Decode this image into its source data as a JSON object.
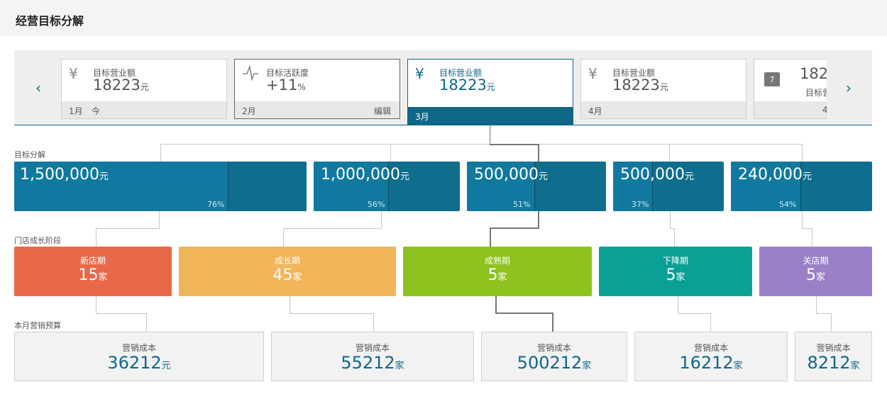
{
  "header": {
    "title": "经营目标分解"
  },
  "carousel": {
    "prev": "‹",
    "next": "›",
    "cards": [
      {
        "icon": "¥",
        "label": "目标营业额",
        "value": "18223",
        "unit": "元",
        "month": "1月",
        "tag": "今",
        "edit": ""
      },
      {
        "icon": "⁄",
        "label": "目标活跃度",
        "value": "+11",
        "unit": "%",
        "month": "2月",
        "tag": "",
        "edit": "编辑"
      },
      {
        "icon": "¥",
        "label": "目标营业额",
        "value": "18223",
        "unit": "元",
        "month": "3月",
        "tag": "",
        "edit": ""
      },
      {
        "icon": "¥",
        "label": "目标营业额",
        "value": "18223",
        "unit": "元",
        "month": "4月",
        "tag": "",
        "edit": ""
      },
      {
        "icon": "7",
        "label": "目标营",
        "value": "182",
        "unit": "",
        "month": "4",
        "tag": "",
        "edit": ""
      }
    ]
  },
  "targets": {
    "section_label": "目标分解",
    "items": [
      {
        "amount": "1,500,000",
        "unit": "元",
        "percent": "76%"
      },
      {
        "amount": "1,000,000",
        "unit": "元",
        "percent": "56%"
      },
      {
        "amount": "500,000",
        "unit": "元",
        "percent": "51%"
      },
      {
        "amount": "500,000",
        "unit": "元",
        "percent": "37%"
      },
      {
        "amount": "240,000",
        "unit": "元",
        "percent": "54%"
      }
    ]
  },
  "stages": {
    "section_label": "门店成长阶段",
    "items": [
      {
        "name": "新店期",
        "count": "15",
        "unit": "家",
        "color": "#e8694a"
      },
      {
        "name": "成长期",
        "count": "45",
        "unit": "家",
        "color": "#f2b55a"
      },
      {
        "name": "成熟期",
        "count": "5",
        "unit": "家",
        "color": "#8dc21f"
      },
      {
        "name": "下降期",
        "count": "5",
        "unit": "家",
        "color": "#0aa096"
      },
      {
        "name": "关店期",
        "count": "5",
        "unit": "家",
        "color": "#9b80c8"
      }
    ]
  },
  "budget": {
    "section_label": "本月营销预算",
    "items": [
      {
        "name": "营销成本",
        "value": "36212",
        "unit": "元"
      },
      {
        "name": "营销成本",
        "value": "55212",
        "unit": "家"
      },
      {
        "name": "营销成本",
        "value": "500212",
        "unit": "家"
      },
      {
        "name": "营销成本",
        "value": "16212",
        "unit": "家"
      },
      {
        "name": "营销成本",
        "value": "8212",
        "unit": "家"
      }
    ]
  }
}
